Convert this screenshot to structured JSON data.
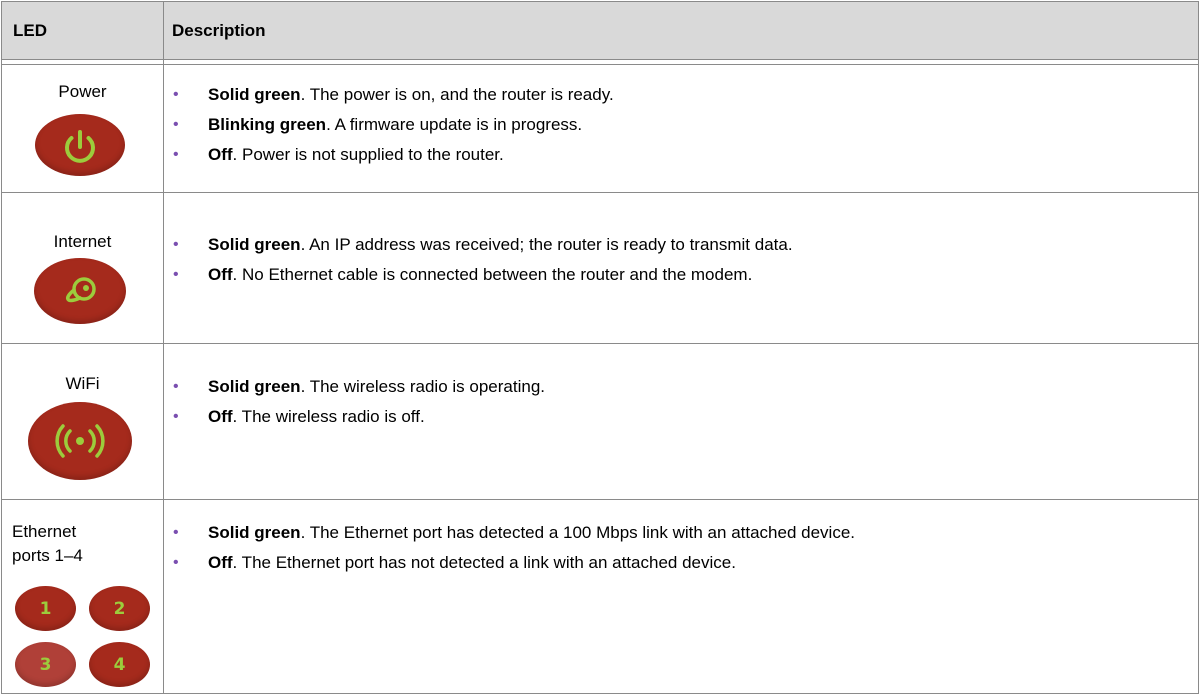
{
  "table": {
    "header": {
      "led": "LED",
      "description": "Description"
    },
    "rows": [
      {
        "led_label": "Power",
        "led_icon": "power-icon",
        "items": [
          {
            "bold": "Solid green",
            "text": ". The power is on, and the router is ready."
          },
          {
            "bold": "Blinking green",
            "text": ". A firmware update is in progress."
          },
          {
            "bold": "Off",
            "text": ". Power is not supplied to the router."
          }
        ]
      },
      {
        "led_label": "Internet",
        "led_icon": "internet-globe-icon",
        "items": [
          {
            "bold": "Solid green",
            "text": ". An IP address was received; the router is ready to transmit data."
          },
          {
            "bold": "Off",
            "text": ". No Ethernet cable is connected between the router and the modem."
          }
        ]
      },
      {
        "led_label": "WiFi",
        "led_icon": "wifi-radio-icon",
        "items": [
          {
            "bold": "Solid green",
            "text": ". The wireless radio is operating."
          },
          {
            "bold": "Off",
            "text": ". The wireless radio is off."
          }
        ]
      },
      {
        "led_label_line1": "Ethernet",
        "led_label_line2": "ports 1–4",
        "port_numbers": [
          "1",
          "2",
          "3",
          "4"
        ],
        "items": [
          {
            "bold": "Solid green",
            "text": ". The Ethernet port has detected a 100 Mbps link with an attached device."
          },
          {
            "bold": "Off",
            "text": ". The Ethernet port has not detected a link with an attached device."
          }
        ]
      }
    ]
  },
  "colors": {
    "header_bg": "#d9d9d9",
    "led_red": "#a52a1c",
    "led_green": "#9ccc3c",
    "bullet_purple": "#7a4fb0",
    "border": "#8a8a8a"
  }
}
